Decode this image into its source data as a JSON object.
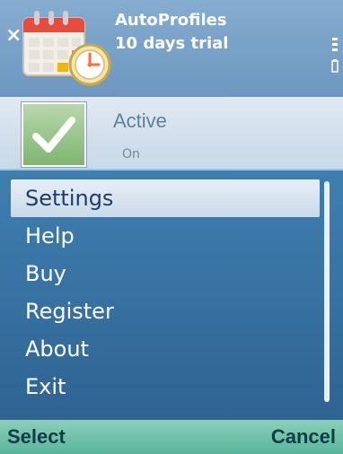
{
  "header": {
    "title_line1": "AutoProfiles",
    "title_line2": "10 days trial",
    "app_icon": "calendar-clock-icon",
    "close_icon": "close-icon"
  },
  "status": {
    "icon": "check-icon",
    "title": "Active",
    "subtitle": "On"
  },
  "menu": {
    "items": [
      {
        "label": "Settings",
        "selected": true
      },
      {
        "label": "Help",
        "selected": false
      },
      {
        "label": "Buy",
        "selected": false
      },
      {
        "label": "Register",
        "selected": false
      },
      {
        "label": "About",
        "selected": false
      },
      {
        "label": "Exit",
        "selected": false
      }
    ]
  },
  "softkeys": {
    "left": "Select",
    "right": "Cancel"
  },
  "colors": {
    "accent": "#6c97c0",
    "selected_bg": "#e7eff7",
    "softkey_bg": "#58b49a"
  }
}
